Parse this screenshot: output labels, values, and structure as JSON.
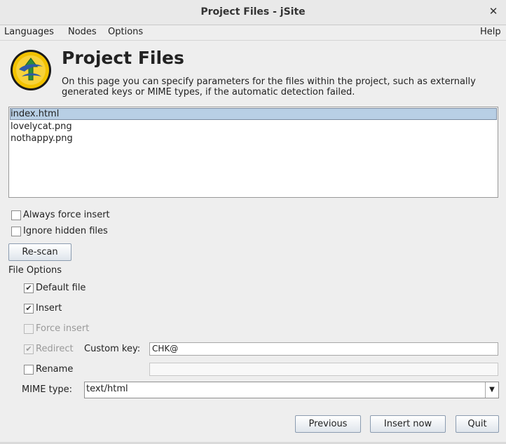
{
  "window": {
    "title": "Project Files - jSite",
    "close_icon": "close-icon"
  },
  "menubar": {
    "languages": "Languages",
    "nodes": "Nodes",
    "options": "Options",
    "help": "Help"
  },
  "header": {
    "title": "Project Files",
    "description": "On this page you can specify parameters for the files within the project, such as externally generated keys or MIME types, if the automatic detection failed."
  },
  "files": [
    "index.html",
    "lovelycat.png",
    "nothappy.png"
  ],
  "selected_file": "index.html",
  "options": {
    "always_force_insert": "Always force insert",
    "always_force_insert_checked": false,
    "ignore_hidden_files": "Ignore hidden files",
    "ignore_hidden_files_checked": false
  },
  "rescan_button": "Re-scan",
  "file_options": {
    "heading": "File Options",
    "default_file": "Default file",
    "default_file_checked": true,
    "insert": "Insert",
    "insert_checked": true,
    "force_insert": "Force insert",
    "force_insert_checked": false,
    "redirect": "Redirect",
    "redirect_checked": true,
    "custom_key_label": "Custom key:",
    "custom_key_value": "CHK@",
    "rename": "Rename",
    "rename_checked": false,
    "rename_value": "",
    "mime_label": "MIME type:",
    "mime_value": "text/html"
  },
  "buttons": {
    "previous": "Previous",
    "insert_now": "Insert now",
    "quit": "Quit"
  }
}
